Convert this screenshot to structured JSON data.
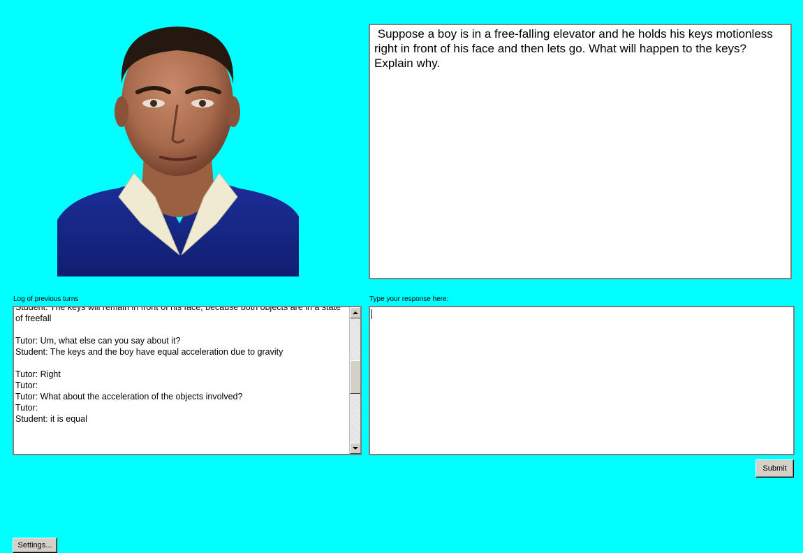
{
  "question": {
    "text": " Suppose a boy is in a free-falling elevator and he holds his keys motionless right in front of his face and then lets go. What will happen to the keys? Explain why."
  },
  "log": {
    "label": "Log of previous turns",
    "lines": [
      "Student: The keys will remain in front of his face, because both objects are in a state of freefall",
      "",
      "Tutor: Um, what else can you say about it?",
      "Student: The keys and the boy have equal acceleration due to gravity",
      "",
      "Tutor: Right",
      "Tutor:",
      "Tutor: What about the acceleration of the objects involved?",
      "Tutor:",
      "Student: it is equal"
    ]
  },
  "response": {
    "label": "Type your response here:",
    "value": ""
  },
  "buttons": {
    "submit": "Submit",
    "settings": "Settings..."
  },
  "colors": {
    "background": "#00FFFF",
    "shirt": "#1a2a8c",
    "skin": "#b07050"
  }
}
